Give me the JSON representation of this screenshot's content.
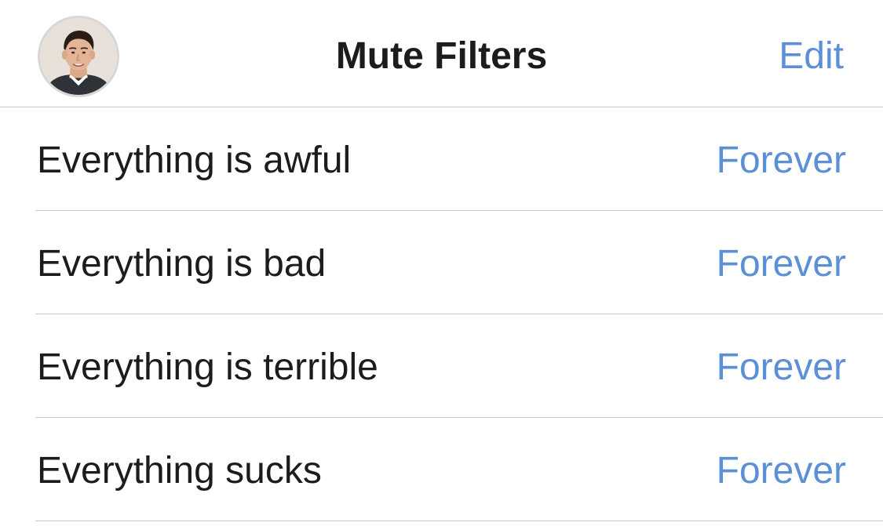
{
  "header": {
    "title": "Mute Filters",
    "edit_label": "Edit",
    "avatar_icon": "user-avatar-photo"
  },
  "colors": {
    "accent": "#5b8fd6",
    "text": "#1c1c1e",
    "separator": "#c8c7cc"
  },
  "filters": [
    {
      "label": "Everything is awful",
      "duration": "Forever"
    },
    {
      "label": "Everything is bad",
      "duration": "Forever"
    },
    {
      "label": "Everything is terrible",
      "duration": "Forever"
    },
    {
      "label": "Everything sucks",
      "duration": "Forever"
    }
  ]
}
